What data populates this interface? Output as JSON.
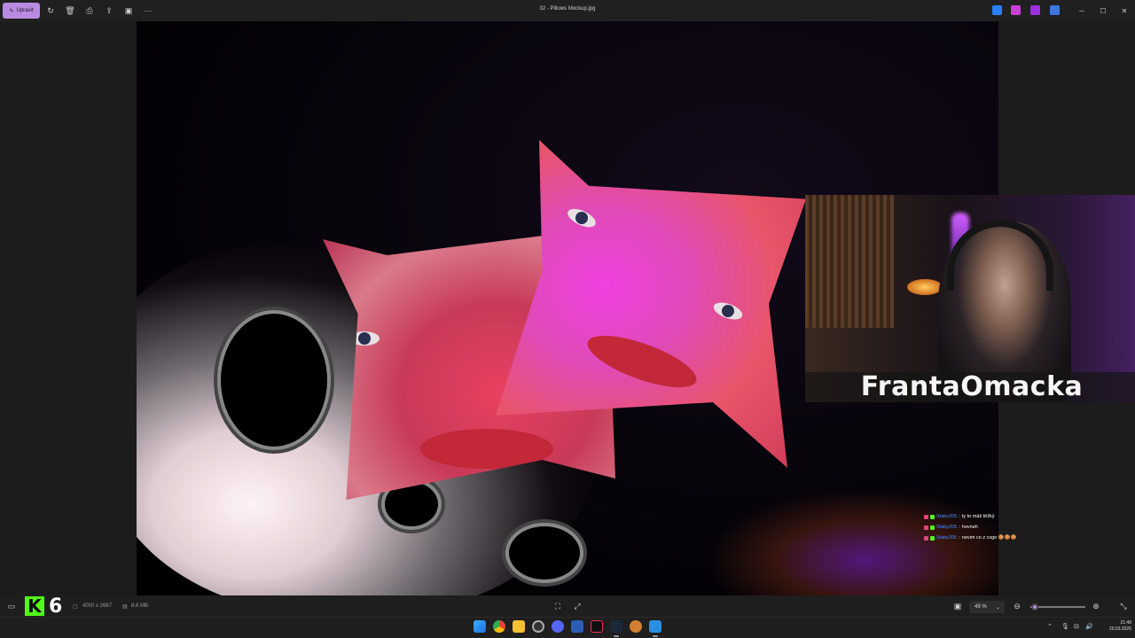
{
  "window": {
    "title": "32 - Pillows Mockup.jpg",
    "edit_label": "Upravit"
  },
  "image": {
    "dimensions": "4000 x 2667",
    "file_size": "8.6 MB"
  },
  "overlay": {
    "streamer_name": "FrantaOmacka",
    "kick_badge": "K",
    "kick_count": "6"
  },
  "chat": [
    {
      "user": "Staby205",
      "sep": ":",
      "message": "ty to máš těžký"
    },
    {
      "user": "Staby205",
      "sep": ":",
      "message": "hovneh"
    },
    {
      "user": "Staby205",
      "sep": ":",
      "message": "nevim co z csgo 🍪🍪🍪"
    }
  ],
  "zoom": {
    "value": "49 %",
    "level_fraction": 0.08
  },
  "taskbar": {
    "time": "21:48",
    "date": "29.03.2026"
  },
  "colors": {
    "accent": "#b98be0",
    "kick_green": "#53fc18",
    "chat_user": "#3f8fff"
  }
}
